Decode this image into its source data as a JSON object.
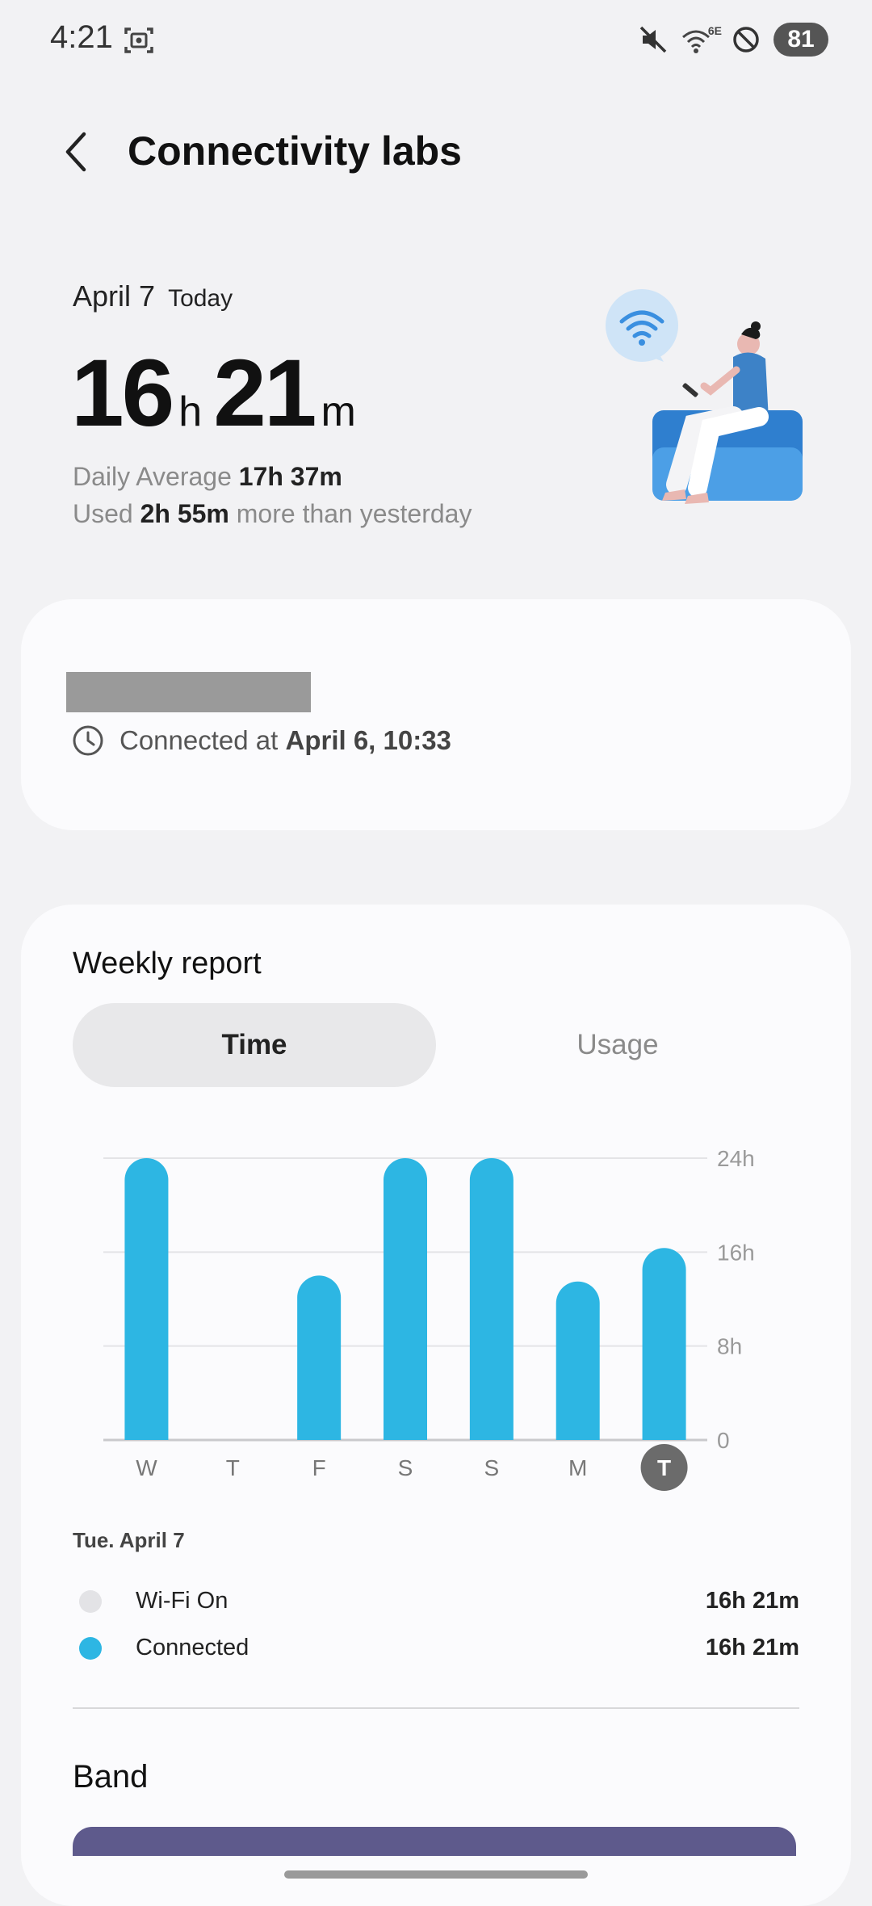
{
  "status_bar": {
    "time": "4:21",
    "wifi_badge": "6E",
    "battery": "81",
    "icons": [
      "screenshot-icon",
      "mute-icon",
      "wifi-6e-icon",
      "do-not-disturb-icon"
    ]
  },
  "header": {
    "title": "Connectivity labs",
    "back_icon": "chevron-left-icon"
  },
  "summary": {
    "date": "April 7",
    "today_label": "Today",
    "hours": "16",
    "hours_unit": "h",
    "minutes": "21",
    "minutes_unit": "m",
    "daily_avg_label": "Daily Average",
    "daily_avg_value": "17h 37m",
    "used_label": "Used",
    "used_value": "2h 55m",
    "used_suffix": "more than yesterday"
  },
  "network": {
    "connected_label": "Connected at",
    "connected_value": "April 6, 10:33"
  },
  "weekly": {
    "title": "Weekly report",
    "tabs": [
      {
        "label": "Time",
        "active": true
      },
      {
        "label": "Usage",
        "active": false
      }
    ],
    "selected_date": "Tue. April 7",
    "legend": [
      {
        "label": "Wi-Fi On",
        "value": "16h 21m",
        "color": "#e3e3e6"
      },
      {
        "label": "Connected",
        "value": "16h 21m",
        "color": "#2db6e3"
      }
    ]
  },
  "chart_data": {
    "type": "bar",
    "categories": [
      "W",
      "T",
      "F",
      "S",
      "S",
      "M",
      "T"
    ],
    "values": [
      24,
      0,
      14,
      24,
      24,
      13.5,
      16.35
    ],
    "ylim": [
      0,
      24
    ],
    "yticks": [
      "0",
      "8h",
      "16h",
      "24h"
    ],
    "selected_index": 6,
    "bar_color": "#2db6e3",
    "grid": true
  },
  "band": {
    "title": "Band"
  },
  "colors": {
    "accent": "#2db6e3",
    "band_bar": "#5e5a8c",
    "background": "#f2f2f4",
    "card": "#fbfbfd"
  }
}
